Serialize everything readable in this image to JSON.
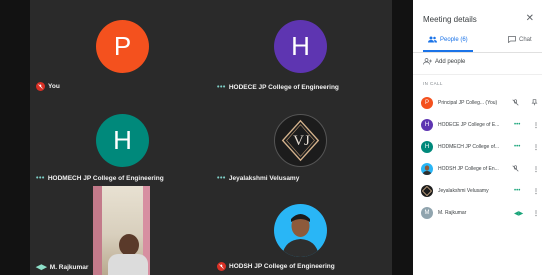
{
  "tiles": [
    {
      "name": "You",
      "initial": "P",
      "color": "#f4511e",
      "status": "muted"
    },
    {
      "name": "HODECE JP College of Engineering",
      "initial": "H",
      "color": "#5e35b1",
      "status": "speaking"
    },
    {
      "name": "HODMECH JP College of Engineering",
      "initial": "H",
      "color": "#00897b",
      "status": "speaking"
    },
    {
      "name": "Jeyalakshmi Velusamy",
      "initial": "VJ",
      "color": "#1c1c1c",
      "status": "speaking"
    },
    {
      "name": "M. Rajkumar",
      "initial": "",
      "color": "",
      "status": "active-mic"
    },
    {
      "name": "HODSH JP College of Engineering",
      "initial": "",
      "color": "#29b6f6",
      "status": "muted"
    }
  ],
  "panel": {
    "title": "Meeting details",
    "tab_people": "People (6)",
    "tab_chat": "Chat",
    "add_people": "Add people",
    "section_label": "IN CALL",
    "participants": [
      {
        "name": "Principal JP Colleg... (You)",
        "initial": "P",
        "color": "#f4511e"
      },
      {
        "name": "HODECE JP College of E...",
        "initial": "H",
        "color": "#5e35b1"
      },
      {
        "name": "HODMECH JP College of...",
        "initial": "H",
        "color": "#00897b"
      },
      {
        "name": "HODSH JP College of En...",
        "initial": "",
        "color": "#29b6f6"
      },
      {
        "name": "Jeyalakshmi Velusamy",
        "initial": "",
        "color": "#1c1c1c"
      },
      {
        "name": "M. Rajkumar",
        "initial": "M",
        "color": "#90a4ae"
      }
    ]
  }
}
